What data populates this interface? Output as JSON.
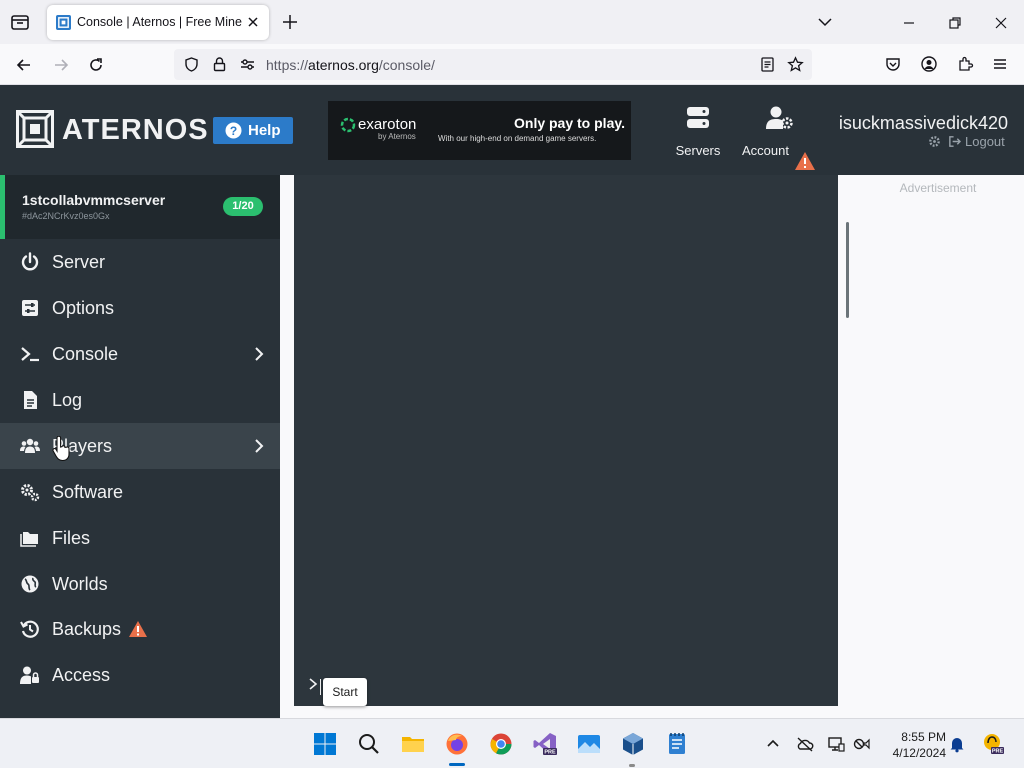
{
  "browser": {
    "tab_title": "Console | Aternos | Free Minecraft Server",
    "url_scheme": "https://",
    "url_host": "aternos.org",
    "url_path": "/console/"
  },
  "header": {
    "logo_text": "ATERNOS",
    "help_label": "Help",
    "ad": {
      "brand": "exaroton",
      "by": "by Aternos",
      "headline": "Only pay to play.",
      "sub": "With our high-end on demand game servers."
    },
    "servers_label": "Servers",
    "account_label": "Account",
    "username": "isuckmassivedick420",
    "logout_label": "Logout"
  },
  "server": {
    "name": "1stcollabvmmcserver",
    "id": "#dAc2NCrKvz0es0Gx",
    "players": "1/20"
  },
  "sidebar": {
    "items": [
      {
        "label": "Server"
      },
      {
        "label": "Options"
      },
      {
        "label": "Console"
      },
      {
        "label": "Log"
      },
      {
        "label": "Players"
      },
      {
        "label": "Software"
      },
      {
        "label": "Files"
      },
      {
        "label": "Worlds"
      },
      {
        "label": "Backups"
      },
      {
        "label": "Access"
      }
    ]
  },
  "console": {
    "tooltip": "Start"
  },
  "right_panel": {
    "ad_label": "Advertisement"
  },
  "taskbar": {
    "time": "8:55 PM",
    "date": "4/12/2024"
  },
  "colors": {
    "header_bg": "#293239",
    "sidebar_bg": "#293239",
    "accent_green": "#2bbf6f",
    "help_blue": "#2c7bc9",
    "warning": "#e8704a"
  }
}
